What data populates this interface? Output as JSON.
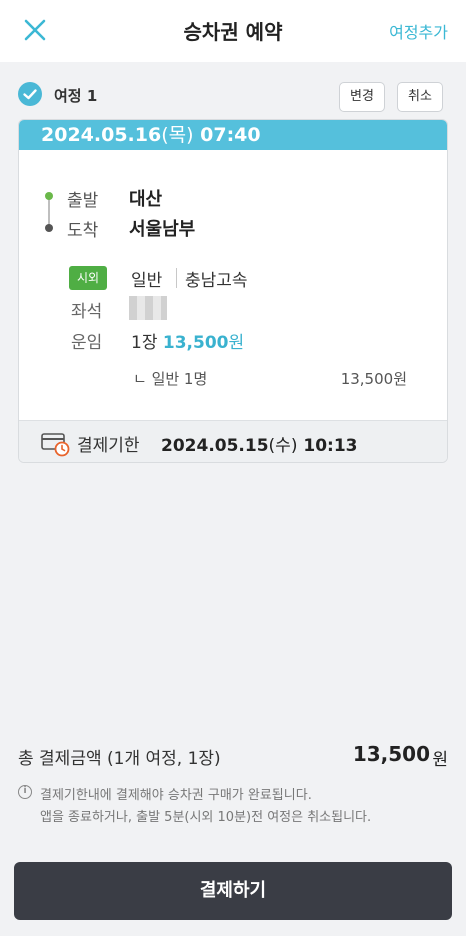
{
  "header": {
    "title": "승차권 예약",
    "add_trip_label": "여정추가",
    "close_icon": "close-icon"
  },
  "trip": {
    "label": "여정 1",
    "change_label": "변경",
    "cancel_label": "취소",
    "date": "2024.05.16",
    "day": "(목)",
    "time": "07:40",
    "departure_label": "출발",
    "departure": "대산",
    "arrival_label": "도착",
    "arrival": "서울남부",
    "route_badge": "시외",
    "bus_class": "일반",
    "company": "충남고속",
    "seat_label": "좌석",
    "fare_label": "운임",
    "ticket_count": "1장",
    "fare_amount": "13,500",
    "fare_unit": "원",
    "detail_text": "ㄴ 일반  1명",
    "detail_amount": "13,500원",
    "deadline_label": "결제기한",
    "deadline_date": "2024.05.15",
    "deadline_day": "(수)",
    "deadline_time": "10:13"
  },
  "summary": {
    "total_label": "총 결제금액 (1개 여정, 1장)",
    "total_amount": "13,500",
    "total_unit": "원",
    "notice_line1": "결제기한내에 결제해야 승차권 구매가 완료됩니다.",
    "notice_line2": "앱을 종료하거나, 출발 5분(시외 10분)전 여정은 취소됩니다."
  },
  "pay_button_label": "결제하기",
  "colors": {
    "accent": "#55c0dc",
    "badge": "#4fae44",
    "pay_button": "#3a3d45"
  }
}
